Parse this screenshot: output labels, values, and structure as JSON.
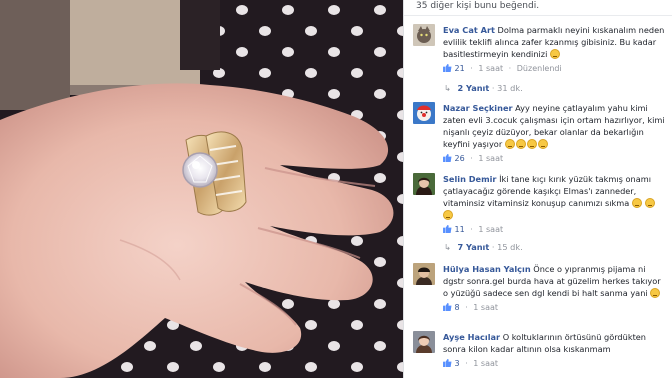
{
  "likes_line": "35 diğer kişi bunu beğendi.",
  "comments": [
    {
      "author": "Eva Cat Art",
      "text": "Dolma parmaklı neyini kıskanalım neden evlilik teklifi alınca zafer kzanmış gibisiniz. Bu kadar basitlestirmeyin kendinizi",
      "likes": "21",
      "time": "1 saat",
      "edited": "Düzenlendi",
      "avatar": "cat-avatar"
    },
    {
      "author": "Nazar Seçkiner",
      "text": "Ayy neyine çatlayalım yahu kimi zaten evli 3.cocuk çalışması için ortam hazırlıyor, kimi nişanlı çeyiz düzüyor, bekar olanlar da bekarlığın keyfini yaşıyor",
      "likes": "26",
      "time": "1 saat",
      "avatar": "clown-avatar"
    },
    {
      "author": "Selin Demir",
      "text": "İki tane kıçı kırık yüzük takmış onamı çatlayacağız görende kaşıkçı Elmas'ı zanneder, vitaminsiz vitaminsiz konuşup canımızı sıkma",
      "likes": "11",
      "time": "1 saat",
      "avatar": "woman-avatar"
    },
    {
      "author": "Hülya Hasan Yalçın",
      "text": "Önce o yıpranmış pijama ni dgstr sonra.gel burda hava at güzelim herkes takıyor o yüzüğü sadece sen dgl kendi bi halt sanma yani",
      "likes": "8",
      "time": "1 saat",
      "avatar": "woman-avatar-2"
    },
    {
      "author": "Ayşe Hacılar",
      "text": "O koltuklarının örtüsünü gördükten sonra kilon kadar altının olsa kıskanmam",
      "likes": "3",
      "time": "1 saat",
      "avatar": "woman-avatar-3"
    }
  ],
  "replies": [
    {
      "label": "2 Yanıt",
      "time": "31 dk."
    },
    {
      "label": "7 Yanıt",
      "time": "15 dk."
    }
  ],
  "colors": {
    "link": "#365899",
    "meta": "#90949c",
    "text": "#1d2129"
  }
}
